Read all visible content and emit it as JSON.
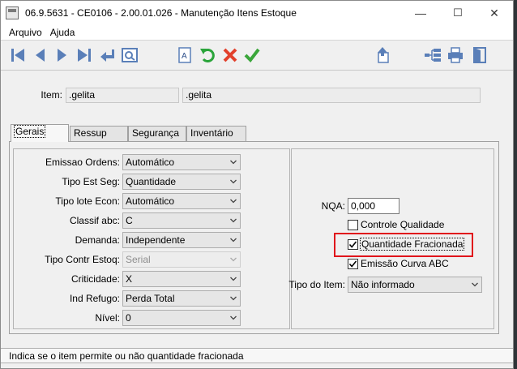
{
  "window": {
    "title": "06.9.5631 - CE0106 - 2.00.01.026 - Manutenção Itens Estoque",
    "controls": {
      "minimize": "—",
      "maximize": "☐",
      "close": "✕"
    }
  },
  "menu": {
    "items": [
      "Arquivo",
      "Ajuda"
    ]
  },
  "toolbar": {
    "icons": [
      "first-record-icon",
      "previous-record-icon",
      "next-record-icon",
      "last-record-icon",
      "goto-icon",
      "search-icon",
      "text-icon",
      "undo-icon",
      "cancel-icon",
      "confirm-icon",
      "import-icon",
      "tree-icon",
      "print-icon",
      "exit-icon"
    ]
  },
  "item": {
    "label": "Item:",
    "code": ".gelita",
    "description": ".gelita"
  },
  "tabs": [
    "Gerais",
    "Ressup",
    "Segurança",
    "Inventário"
  ],
  "left_fields": [
    {
      "label": "Emissao Ordens:",
      "value": "Automático",
      "disabled": false
    },
    {
      "label": "Tipo Est Seg:",
      "value": "Quantidade",
      "disabled": false
    },
    {
      "label": "Tipo lote Econ:",
      "value": "Automático",
      "disabled": false
    },
    {
      "label": "Classif abc:",
      "value": "C",
      "disabled": false
    },
    {
      "label": "Demanda:",
      "value": "Independente",
      "disabled": false
    },
    {
      "label": "Tipo Contr Estoq:",
      "value": "Serial",
      "disabled": true
    },
    {
      "label": "Criticidade:",
      "value": "X",
      "disabled": false
    },
    {
      "label": "Ind Refugo:",
      "value": "Perda Total",
      "disabled": false
    },
    {
      "label": "Nível:",
      "value": "0",
      "disabled": false
    }
  ],
  "right": {
    "nqa_label": "NQA:",
    "nqa_value": "0,000",
    "checkboxes": [
      {
        "label": "Controle Qualidade",
        "checked": false
      },
      {
        "label": "Quantidade Fracionada",
        "checked": true
      },
      {
        "label": "Emissão Curva ABC",
        "checked": true
      }
    ],
    "tipo_item_label": "Tipo do Item:",
    "tipo_item_value": "Não informado"
  },
  "status": {
    "text": "Indica se o item permite ou não quantidade fracionada"
  },
  "colors": {
    "highlight": "#e0141b",
    "nav_blue": "#5a7fb8",
    "undo_green": "#2aa43a",
    "cancel_red": "#e2402b",
    "confirm_green": "#3aa63a"
  }
}
